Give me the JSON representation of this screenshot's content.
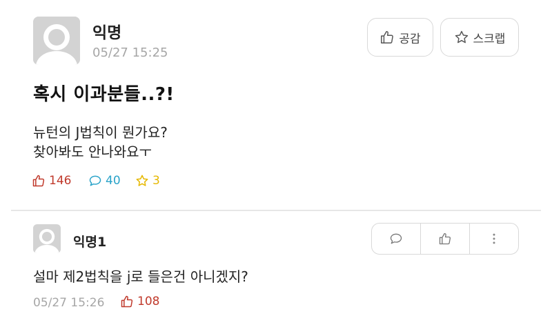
{
  "post": {
    "author": "익명",
    "timestamp": "05/27 15:25",
    "like_button_label": "공감",
    "scrap_button_label": "스크랩",
    "title": "혹시 이과분들..?!",
    "body_lines": [
      "뉴턴의 J법칙이 뭔가요?",
      "찾아봐도 안나와요ㅜ"
    ],
    "stats": {
      "likes": "146",
      "comments": "40",
      "scraps": "3"
    }
  },
  "comment": {
    "author": "익명1",
    "text": "설마 제2법칙을 j로 들은건 아니겠지?",
    "timestamp": "05/27 15:26",
    "likes": "108"
  },
  "icons": {
    "like": "thumbs-up-icon",
    "scrap": "star-icon",
    "comment": "speech-bubble-icon",
    "more": "vertical-dots-icon"
  },
  "colors": {
    "like": "#c0392b",
    "comment": "#2aa3c9",
    "scrap": "#e6b800",
    "muted": "#a6a6a6"
  }
}
